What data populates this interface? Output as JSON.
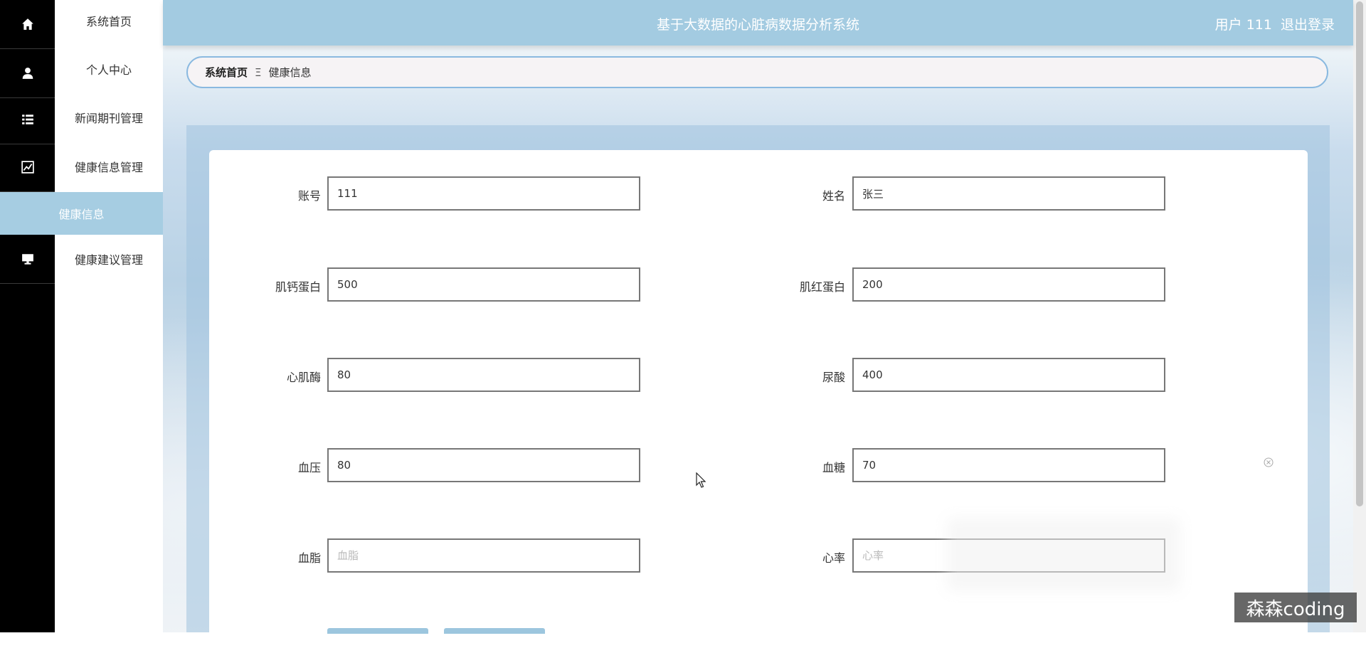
{
  "app": {
    "title": "基于大数据的心脏病数据分析系统",
    "user_label": "用户 111",
    "logout_label": "退出登录"
  },
  "sidebar": {
    "items": [
      {
        "label": "系统首页",
        "icon": "home-icon"
      },
      {
        "label": "个人中心",
        "icon": "user-icon"
      },
      {
        "label": "新闻期刊管理",
        "icon": "list-icon"
      },
      {
        "label": "健康信息管理",
        "icon": "chart-icon"
      },
      {
        "label": "健康建议管理",
        "icon": "monitor-icon"
      }
    ],
    "active_sub": "健康信息"
  },
  "breadcrumb": {
    "home": "系统首页",
    "separator": "Ξ",
    "current": "健康信息"
  },
  "form": {
    "fields": [
      {
        "label": "账号",
        "value": "111",
        "placeholder": ""
      },
      {
        "label": "姓名",
        "value": "张三",
        "placeholder": ""
      },
      {
        "label": "肌钙蛋白",
        "value": "500",
        "placeholder": ""
      },
      {
        "label": "肌红蛋白",
        "value": "200",
        "placeholder": ""
      },
      {
        "label": "心肌酶",
        "value": "80",
        "placeholder": ""
      },
      {
        "label": "尿酸",
        "value": "400",
        "placeholder": ""
      },
      {
        "label": "血压",
        "value": "80",
        "placeholder": ""
      },
      {
        "label": "血糖",
        "value": "70",
        "placeholder": ""
      },
      {
        "label": "血脂",
        "value": "",
        "placeholder": "血脂"
      },
      {
        "label": "心率",
        "value": "",
        "placeholder": "心率"
      }
    ]
  },
  "watermark": "森森coding",
  "colors": {
    "header": "#a3cbe1",
    "active_menu": "#a6cde2",
    "rail": "#000000",
    "breadcrumb_border": "#8ab9e0"
  }
}
